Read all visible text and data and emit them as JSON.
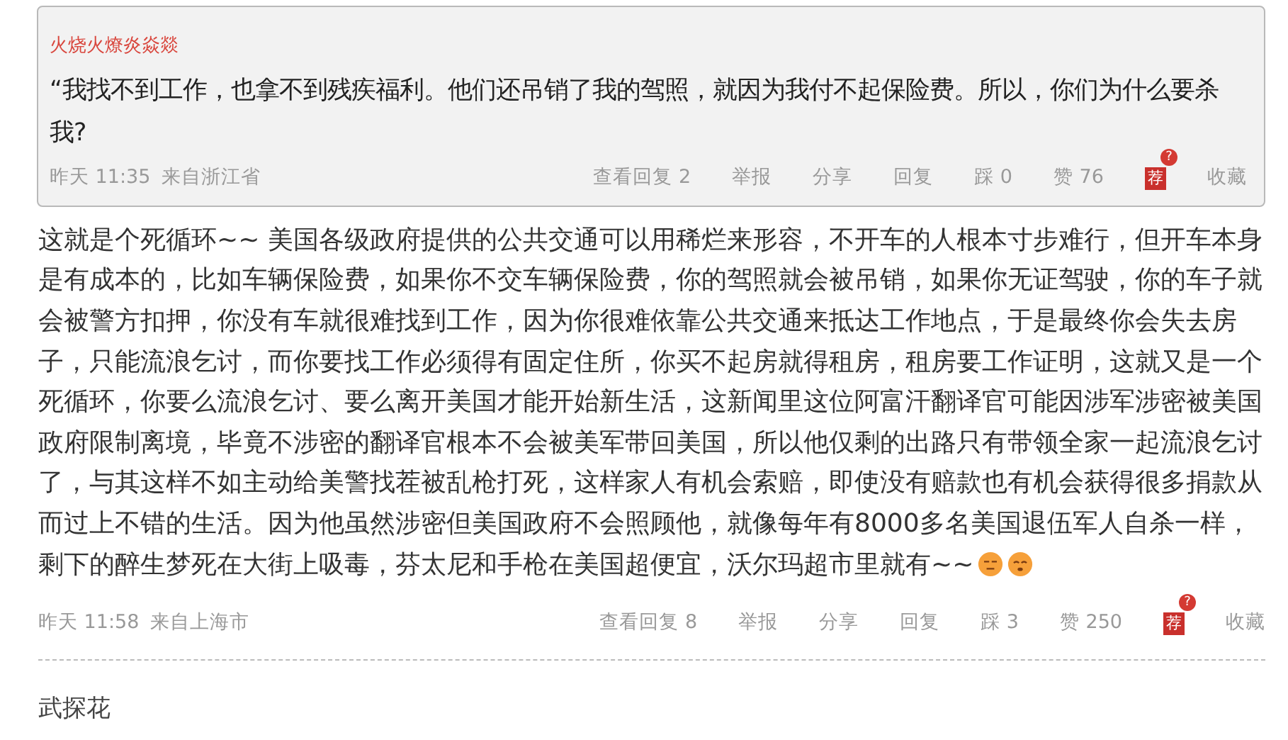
{
  "quote": {
    "author": "火烧火燎炎焱燚",
    "text": "“我找不到工作，也拿不到残疾福利。他们还吊销了我的驾照，就因为我付不起保险费。所以，你们为什么要杀我?",
    "meta": {
      "time": "昨天 11:35",
      "location": "来自浙江省",
      "actions": [
        {
          "kind": "text",
          "label": "查看回复 2"
        },
        {
          "kind": "text",
          "label": "举报"
        },
        {
          "kind": "text",
          "label": "分享"
        },
        {
          "kind": "text",
          "label": "回复"
        },
        {
          "kind": "text",
          "label": "踩 0"
        },
        {
          "kind": "text",
          "label": "赞 76"
        },
        {
          "kind": "recommend",
          "label": "荐",
          "badge": "?"
        },
        {
          "kind": "text",
          "label": "收藏"
        }
      ]
    }
  },
  "comment": {
    "text": "这就是个死循环~~ 美国各级政府提供的公共交通可以用稀烂来形容，不开车的人根本寸步难行，但开车本身是有成本的，比如车辆保险费，如果你不交车辆保险费，你的驾照就会被吊销，如果你无证驾驶，你的车子就会被警方扣押，你没有车就很难找到工作，因为你很难依靠公共交通来抵达工作地点，于是最终你会失去房子，只能流浪乞讨，而你要找工作必须得有固定住所，你买不起房就得租房，租房要工作证明，这就又是一个死循环，你要么流浪乞讨、要么离开美国才能开始新生活，这新闻里这位阿富汗翻译官可能因涉军涉密被美国政府限制离境，毕竟不涉密的翻译官根本不会被美军带回美国，所以他仅剩的出路只有带领全家一起流浪乞讨了，与其这样不如主动给美警找茬被乱枪打死，这样家人有机会索赔，即使没有赔款也有机会获得很多捐款从而过上不错的生活。因为他虽然涉密但美国政府不会照顾他，就像每年有8000多名美国退伍军人自杀一样，剩下的醉生梦死在大街上吸毒，芬太尼和手枪在美国超便宜，沃尔玛超市里就有~~",
    "meta": {
      "time": "昨天 11:58",
      "location": "来自上海市",
      "actions": [
        {
          "kind": "text",
          "label": "查看回复 8"
        },
        {
          "kind": "text",
          "label": "举报"
        },
        {
          "kind": "text",
          "label": "分享"
        },
        {
          "kind": "text",
          "label": "回复"
        },
        {
          "kind": "text",
          "label": "踩 3"
        },
        {
          "kind": "text",
          "label": "赞 250"
        },
        {
          "kind": "recommend",
          "label": "荐",
          "badge": "?"
        },
        {
          "kind": "text",
          "label": "收藏"
        }
      ]
    }
  },
  "next_author": "武探花"
}
